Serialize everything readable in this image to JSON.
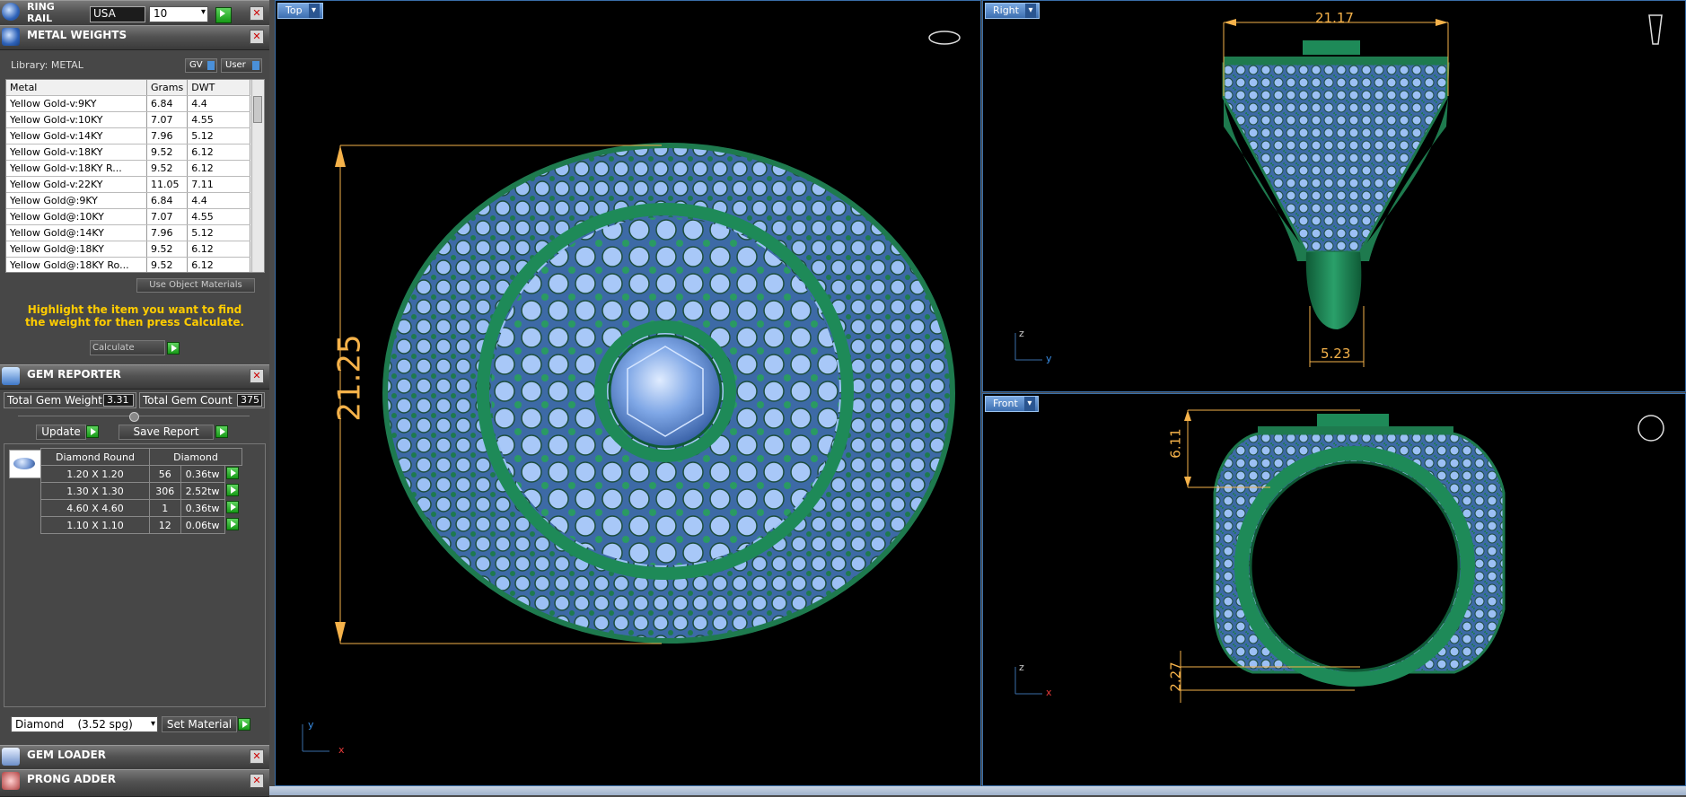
{
  "ring_rail": {
    "title": "RING\nRAIL",
    "country": "USA",
    "size": "10"
  },
  "metal_weights": {
    "title": "METAL WEIGHTS",
    "library_label": "Library: METAL",
    "gv_label": "GV",
    "user_label": "User",
    "columns": [
      "Metal",
      "Grams",
      "DWT"
    ],
    "rows": [
      {
        "metal": "Yellow Gold-v:9KY",
        "grams": "6.84",
        "dwt": "4.4"
      },
      {
        "metal": "Yellow Gold-v:10KY",
        "grams": "7.07",
        "dwt": "4.55"
      },
      {
        "metal": "Yellow Gold-v:14KY",
        "grams": "7.96",
        "dwt": "5.12"
      },
      {
        "metal": "Yellow Gold-v:18KY",
        "grams": "9.52",
        "dwt": "6.12"
      },
      {
        "metal": "Yellow Gold-v:18KY R...",
        "grams": "9.52",
        "dwt": "6.12"
      },
      {
        "metal": "Yellow Gold-v:22KY",
        "grams": "11.05",
        "dwt": "7.11"
      },
      {
        "metal": "Yellow Gold@:9KY",
        "grams": "6.84",
        "dwt": "4.4"
      },
      {
        "metal": "Yellow Gold@:10KY",
        "grams": "7.07",
        "dwt": "4.55"
      },
      {
        "metal": "Yellow Gold@:14KY",
        "grams": "7.96",
        "dwt": "5.12"
      },
      {
        "metal": "Yellow Gold@:18KY",
        "grams": "9.52",
        "dwt": "6.12"
      },
      {
        "metal": "Yellow Gold@:18KY Ro...",
        "grams": "9.52",
        "dwt": "6.12"
      }
    ],
    "use_object_materials": "Use Object Materials",
    "instruction": "Highlight the item you want to find the weight for then press Calculate.",
    "calculate": "Calculate"
  },
  "gem_reporter": {
    "title": "GEM REPORTER",
    "total_weight_label": "Total Gem Weight",
    "total_weight": "3.31",
    "total_count_label": "Total Gem Count",
    "total_count": "375",
    "update": "Update",
    "save_report": "Save Report",
    "columns": [
      "Diamond Round",
      "Diamond"
    ],
    "rows": [
      {
        "size": "1.20 X 1.20",
        "count": "56",
        "weight": "0.36tw"
      },
      {
        "size": "1.30 X 1.30",
        "count": "306",
        "weight": "2.52tw"
      },
      {
        "size": "4.60 X 4.60",
        "count": "1",
        "weight": "0.36tw"
      },
      {
        "size": "1.10 X 1.10",
        "count": "12",
        "weight": "0.06tw"
      }
    ],
    "material": "Diamond    (3.52 spg)",
    "set_material": "Set Material"
  },
  "gem_loader": {
    "title": "GEM LOADER"
  },
  "prong_adder": {
    "title": "PRONG ADDER"
  },
  "viewports": {
    "top": {
      "label": "Top",
      "dim": "21.25",
      "axis_y": "y",
      "axis_x": "x"
    },
    "right": {
      "label": "Right",
      "dim_top": "21.17",
      "dim_bottom": "5.23",
      "axis_z": "z",
      "axis_y": "y"
    },
    "front": {
      "label": "Front",
      "dim_top": "6.11",
      "dim_bottom": "2.27",
      "axis_z": "z",
      "axis_x": "x"
    }
  },
  "colors": {
    "metal": "#1e7a4e",
    "gem": "#8fb6f0",
    "dimension": "#f5b24a",
    "viewport_border": "#3a6ea8"
  }
}
